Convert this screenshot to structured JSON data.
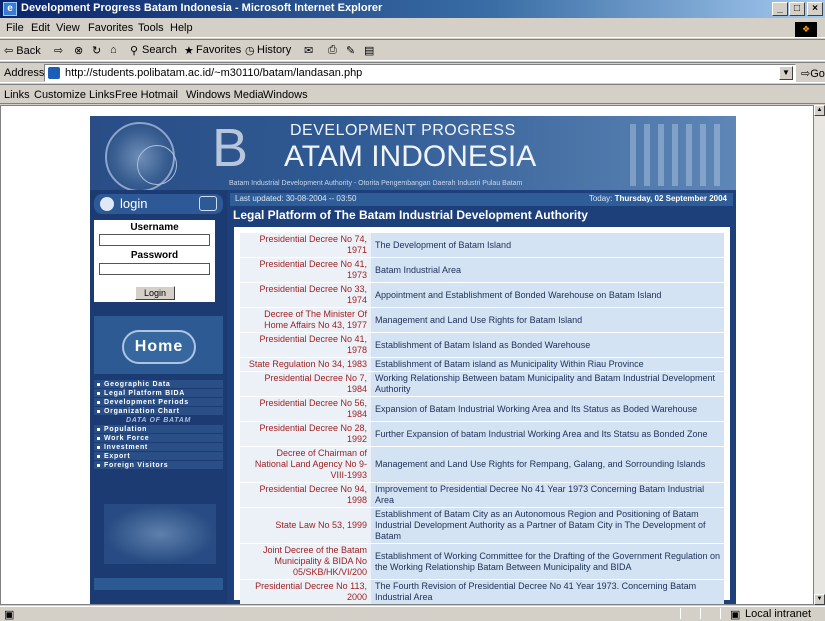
{
  "window": {
    "title": "Development Progress Batam Indonesia - Microsoft Internet Explorer",
    "min": "_",
    "max": "□",
    "close": "×"
  },
  "menu": [
    "File",
    "Edit",
    "View",
    "Favorites",
    "Tools",
    "Help"
  ],
  "toolbar": {
    "back": "⇦ Back",
    "forward": "⇨",
    "stop": "⊗",
    "refresh": "↻",
    "home": "⌂",
    "search": "Search",
    "favorites": "Favorites",
    "history": "History",
    "mail": "✉",
    "print": "⎙",
    "edit": "✎",
    "discuss": "▤"
  },
  "address": {
    "label": "Address",
    "url": "http://students.polibatam.ac.id/~m30110/batam/landasan.php",
    "go": "Go"
  },
  "links": {
    "label": "Links",
    "items": [
      "Customize Links",
      "Free Hotmail",
      "Windows Media",
      "Windows"
    ]
  },
  "banner": {
    "letter": "B",
    "line1": "DEVELOPMENT PROGRESS",
    "line2": "ATAM INDONESIA",
    "tagline": "Batam Industrial Development Authority - Otorita Pengembangan Daerah Industri Pulau Batam"
  },
  "login": {
    "title": "login",
    "username_label": "Username",
    "password_label": "Password",
    "button": "Login"
  },
  "home_label": "Home",
  "nav": [
    {
      "label": "Geographic Data",
      "sub": false
    },
    {
      "label": "Legal Platform BIDA",
      "sub": false
    },
    {
      "label": "Development Periods",
      "sub": false
    },
    {
      "label": "Organization Chart",
      "sub": false
    },
    {
      "label": "DATA OF BATAM",
      "sub": true
    },
    {
      "label": "Population",
      "sub": false
    },
    {
      "label": "Work Force",
      "sub": false
    },
    {
      "label": "Investment",
      "sub": false
    },
    {
      "label": "Export",
      "sub": false
    },
    {
      "label": "Foreign Visitors",
      "sub": false
    }
  ],
  "info": {
    "updated": "Last updated: 30-08-2004 -- 03:50",
    "today_label": "Today:",
    "today_value": "Thursday, 02 September 2004"
  },
  "heading": "Legal Platform of The Batam Industrial Development Authority",
  "table": [
    {
      "k": "Presidential Decree No 74, 1971",
      "v": "The Development of Batam Island"
    },
    {
      "k": "Presidential Decree No 41, 1973",
      "v": "Batam Industrial Area"
    },
    {
      "k": "Presidential Decree No 33, 1974",
      "v": "Appointment and Establishment of Bonded Warehouse on Batam Island"
    },
    {
      "k": "Decree of The Minister Of Home Affairs No 43, 1977",
      "v": "Management and Land Use Rights for Batam Island"
    },
    {
      "k": "Presidential Decree No 41, 1978",
      "v": "Establishment of Batam Island as Bonded Warehouse"
    },
    {
      "k": "State Regulation No 34, 1983",
      "v": "Establishment of Batam island as Municipality Within Riau Province"
    },
    {
      "k": "Presidential Decree No 7, 1984",
      "v": "Working Relationship Between batam Municipality and Batam Industrial Development Authority"
    },
    {
      "k": "Presidential Decree No 56, 1984",
      "v": "Expansion of Batam Industrial Working Area and Its Status as Boded Warehouse"
    },
    {
      "k": "Presidential Decree No 28, 1992",
      "v": "Further Expansion of batam Industrial Working Area and Its Statsu as Bonded Zone"
    },
    {
      "k": "Decree of Chairman of National Land Agency No 9-VIII-1993",
      "v": "Management and Land Use Rights for Rempang, Galang, and Sorrounding Islands"
    },
    {
      "k": "Presidential Decree No 94, 1998",
      "v": "Improvement to Presidential Decree No 41 Year 1973 Concerning Batam Industrial Area"
    },
    {
      "k": "State Law No 53, 1999",
      "v": "Establishment of Batam City as an Autonomous Region and Positioning of Batam Industrial Development Authority as a Partner of Batam City in The Development of Batam"
    },
    {
      "k": "Joint Decree of the Batam Municipality & BIDA No 05/SKB/HK/VI/200",
      "v": "Establishment of Working Committee for the Drafting of the Government Regulation on the Working Relationship Batam Between Municipality and BIDA"
    },
    {
      "k": "Presidential Decree No 113, 2000",
      "v": "The Fourth Revision of Presidential Decree No 41 Year 1973. Concerning Batam Industrial Area"
    }
  ],
  "status": {
    "zone": "Local intranet"
  }
}
